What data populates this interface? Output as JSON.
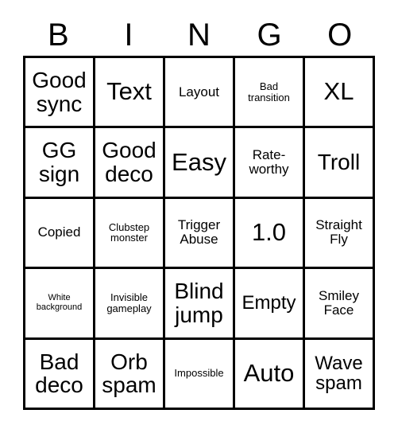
{
  "card": {
    "headers": [
      "B",
      "I",
      "N",
      "G",
      "O"
    ],
    "rows": [
      [
        {
          "text": "Good\nsync",
          "size": "fs-lg"
        },
        {
          "text": "Text",
          "size": "fs-xl"
        },
        {
          "text": "Layout",
          "size": "fs-sm"
        },
        {
          "text": "Bad\ntransition",
          "size": "fs-xs"
        },
        {
          "text": "XL",
          "size": "fs-xl"
        }
      ],
      [
        {
          "text": "GG\nsign",
          "size": "fs-lg"
        },
        {
          "text": "Good\ndeco",
          "size": "fs-lg"
        },
        {
          "text": "Easy",
          "size": "fs-xl"
        },
        {
          "text": "Rate-\nworthy",
          "size": "fs-sm"
        },
        {
          "text": "Troll",
          "size": "fs-lg"
        }
      ],
      [
        {
          "text": "Copied",
          "size": "fs-sm"
        },
        {
          "text": "Clubstep\nmonster",
          "size": "fs-xs"
        },
        {
          "text": "Trigger\nAbuse",
          "size": "fs-sm"
        },
        {
          "text": "1.0",
          "size": "fs-xl"
        },
        {
          "text": "Straight\nFly",
          "size": "fs-sm"
        }
      ],
      [
        {
          "text": "White\nbackground",
          "size": "fs-xxs"
        },
        {
          "text": "Invisible\ngameplay",
          "size": "fs-xs"
        },
        {
          "text": "Blind\njump",
          "size": "fs-lg"
        },
        {
          "text": "Empty",
          "size": "fs-md"
        },
        {
          "text": "Smiley\nFace",
          "size": "fs-sm"
        }
      ],
      [
        {
          "text": "Bad\ndeco",
          "size": "fs-lg"
        },
        {
          "text": "Orb\nspam",
          "size": "fs-lg"
        },
        {
          "text": "Impossible",
          "size": "fs-xs"
        },
        {
          "text": "Auto",
          "size": "fs-xl"
        },
        {
          "text": "Wave\nspam",
          "size": "fs-md"
        }
      ]
    ]
  }
}
